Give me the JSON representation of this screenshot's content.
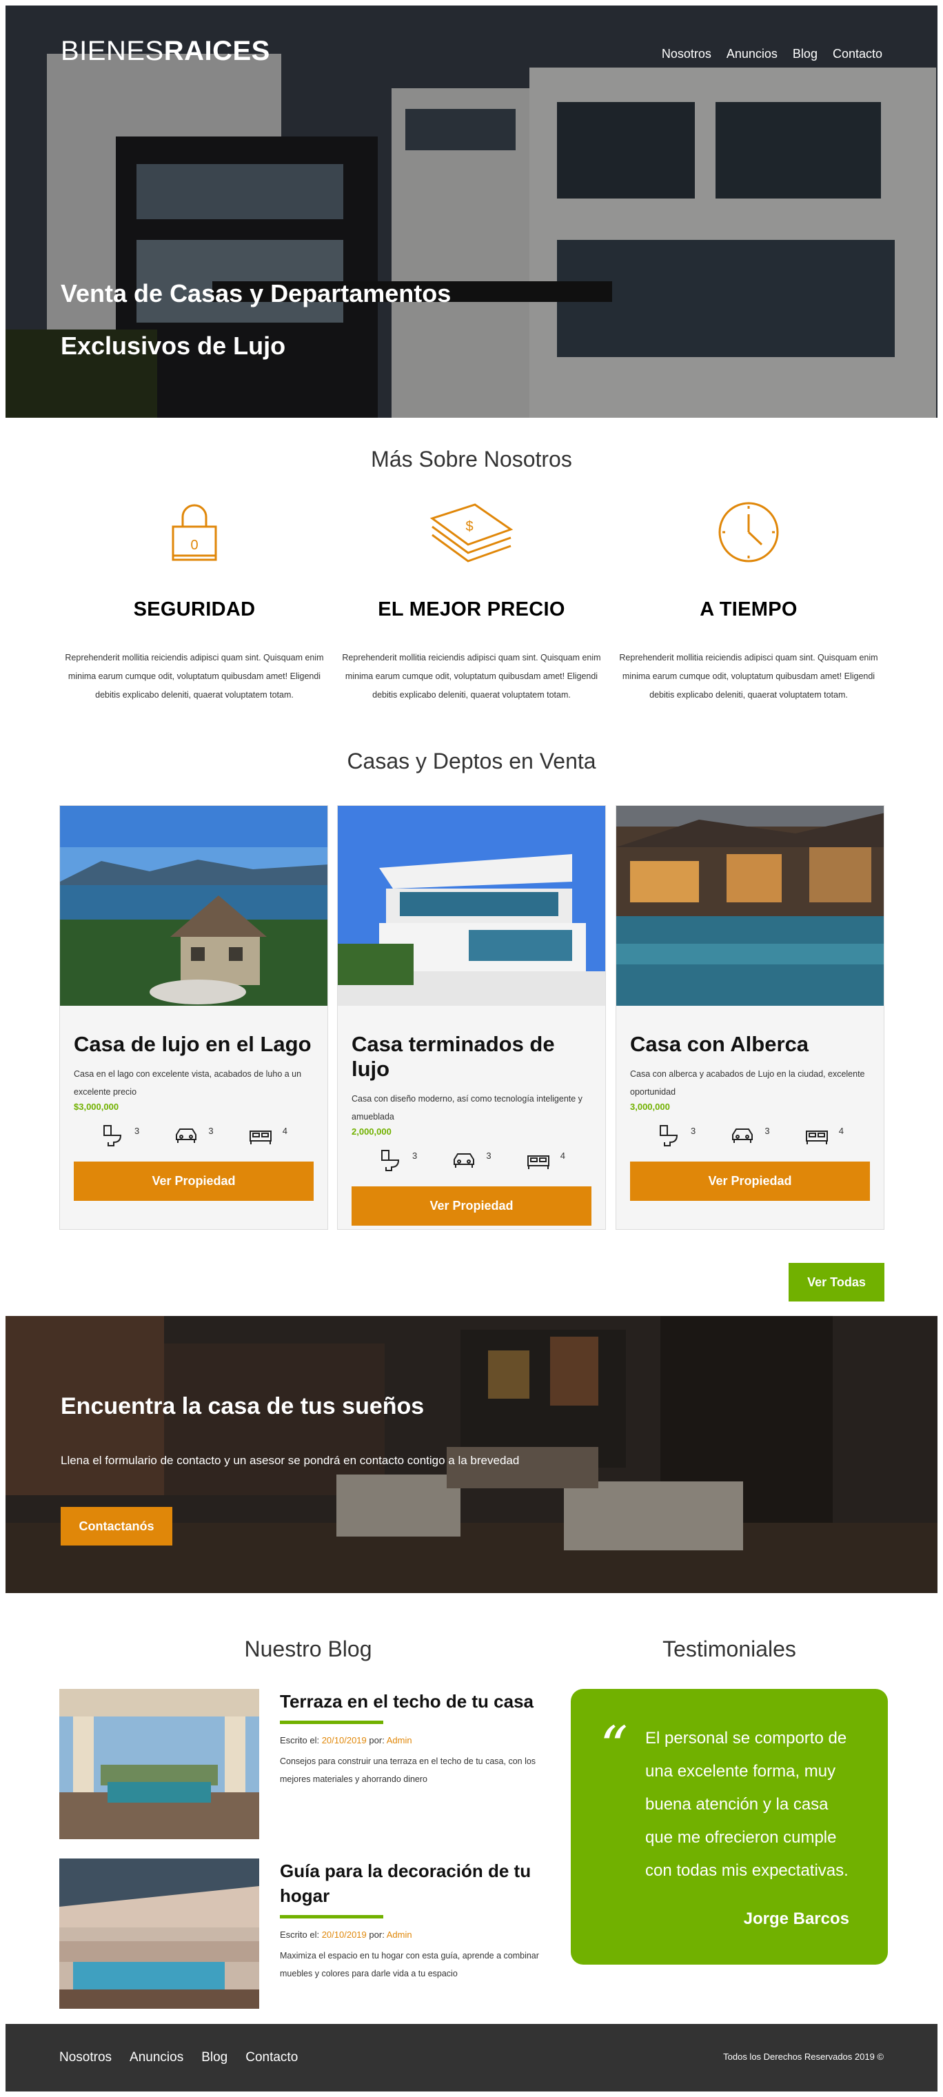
{
  "header": {
    "logo_light": "BIENES",
    "logo_bold": "RAICES",
    "nav": [
      "Nosotros",
      "Anuncios",
      "Blog",
      "Contacto"
    ],
    "hero_title": "Venta de Casas y Departamentos Exclusivos de Lujo"
  },
  "about": {
    "title": "Más Sobre Nosotros",
    "features": [
      {
        "icon": "lock-icon",
        "title": "SEGURIDAD",
        "text": "Reprehenderit mollitia reiciendis adipisci quam sint. Quisquam enim minima earum cumque odit, voluptatum quibusdam amet! Eligendi debitis explicabo deleniti, quaerat voluptatem totam."
      },
      {
        "icon": "money-icon",
        "title": "EL MEJOR PRECIO",
        "text": "Reprehenderit mollitia reiciendis adipisci quam sint. Quisquam enim minima earum cumque odit, voluptatum quibusdam amet! Eligendi debitis explicabo deleniti, quaerat voluptatem totam."
      },
      {
        "icon": "clock-icon",
        "title": "A TIEMPO",
        "text": "Reprehenderit mollitia reiciendis adipisci quam sint. Quisquam enim minima earum cumque odit, voluptatum quibusdam amet! Eligendi debitis explicabo deleniti, quaerat voluptatem totam."
      }
    ]
  },
  "listings": {
    "title": "Casas y Deptos en Venta",
    "button_label": "Ver Propiedad",
    "view_all": "Ver Todas",
    "items": [
      {
        "title": "Casa de lujo en el Lago",
        "desc": "Casa en el lago con excelente vista, acabados de luho a un excelente precio",
        "price": "$3,000,000",
        "baths": "3",
        "parking": "3",
        "rooms": "4"
      },
      {
        "title": "Casa terminados de lujo",
        "desc": "Casa con diseño moderno, así como tecnología inteligente y amueblada",
        "price": "2,000,000",
        "baths": "3",
        "parking": "3",
        "rooms": "4"
      },
      {
        "title": "Casa con Alberca",
        "desc": "Casa con alberca y acabados de Lujo en la ciudad, excelente oportunidad",
        "price": "3,000,000",
        "baths": "3",
        "parking": "3",
        "rooms": "4"
      }
    ]
  },
  "contact_banner": {
    "title": "Encuentra la casa de tus sueños",
    "text": "Llena el formulario de contacto y un asesor se pondrá en contacto contigo a la brevedad",
    "button": "Contactanós"
  },
  "blog": {
    "title": "Nuestro Blog",
    "entries": [
      {
        "title": "Terraza en el techo de tu casa",
        "written_label": "Escrito el:",
        "date": "20/10/2019",
        "by_label": "por:",
        "author": "Admin",
        "excerpt": "Consejos para construir una terraza en el techo de tu casa, con los mejores materiales y ahorrando dinero"
      },
      {
        "title": "Guía para la decoración de tu hogar",
        "written_label": "Escrito el:",
        "date": "20/10/2019",
        "by_label": "por:",
        "author": "Admin",
        "excerpt": "Maximiza el espacio en tu hogar con esta guía, aprende a combinar muebles y colores para darle vida a tu espacio"
      }
    ]
  },
  "testimonials": {
    "title": "Testimoniales",
    "quote_mark": "“",
    "text": "El personal se comporto de una excelente forma, muy buena atención y la casa que me ofrecieron cumple con todas mis expectativas.",
    "author": "Jorge Barcos"
  },
  "footer": {
    "nav": [
      "Nosotros",
      "Anuncios",
      "Blog",
      "Contacto"
    ],
    "copyright": "Todos los Derechos Reservados 2019 ©"
  },
  "colors": {
    "primary": "#e08709",
    "secondary": "#71b100",
    "dark": "#333333"
  }
}
